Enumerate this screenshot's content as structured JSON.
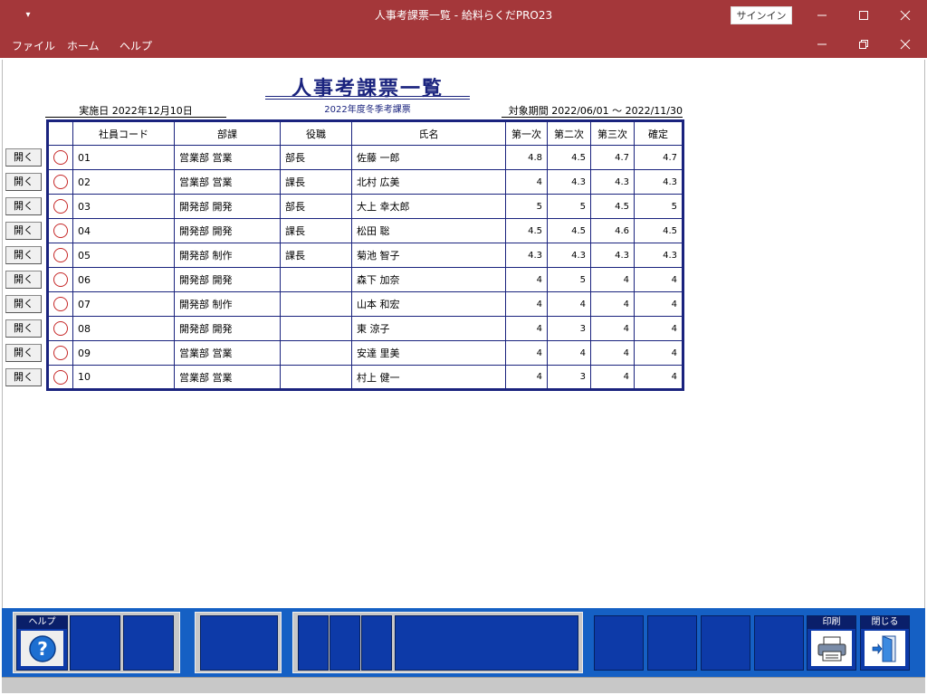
{
  "window": {
    "qat_glyph": "▾",
    "title": "人事考課票一覧 - 給料らくだPRO23",
    "signin_label": "サインイン"
  },
  "menu": {
    "items": [
      "ファイル",
      "ホーム",
      "ヘルプ"
    ]
  },
  "report": {
    "title": "人事考課票一覧",
    "subtitle": "2022年度冬季考課票",
    "implementation_date": "実施日 2022年12月10日",
    "period": "対象期間 2022/06/01 ～ 2022/11/30"
  },
  "table": {
    "headers": [
      "",
      "社員コード",
      "部課",
      "役職",
      "氏名",
      "第一次",
      "第二次",
      "第三次",
      "確定"
    ],
    "open_label": "開く",
    "rows": [
      {
        "code": "01",
        "dept": "営業部 営業",
        "position": "部長",
        "name": "佐藤 一郎",
        "r1": "4.8",
        "r2": "4.5",
        "r3": "4.7",
        "final": "4.7"
      },
      {
        "code": "02",
        "dept": "営業部 営業",
        "position": "課長",
        "name": "北村 広美",
        "r1": "4",
        "r2": "4.3",
        "r3": "4.3",
        "final": "4.3"
      },
      {
        "code": "03",
        "dept": "開発部 開発",
        "position": "部長",
        "name": "大上 幸太郎",
        "r1": "5",
        "r2": "5",
        "r3": "4.5",
        "final": "5"
      },
      {
        "code": "04",
        "dept": "開発部 開発",
        "position": "課長",
        "name": "松田 聡",
        "r1": "4.5",
        "r2": "4.5",
        "r3": "4.6",
        "final": "4.5"
      },
      {
        "code": "05",
        "dept": "開発部 制作",
        "position": "課長",
        "name": "菊池 智子",
        "r1": "4.3",
        "r2": "4.3",
        "r3": "4.3",
        "final": "4.3"
      },
      {
        "code": "06",
        "dept": "開発部 開発",
        "position": "",
        "name": "森下 加奈",
        "r1": "4",
        "r2": "5",
        "r3": "4",
        "final": "4"
      },
      {
        "code": "07",
        "dept": "開発部 制作",
        "position": "",
        "name": "山本 和宏",
        "r1": "4",
        "r2": "4",
        "r3": "4",
        "final": "4"
      },
      {
        "code": "08",
        "dept": "開発部 開発",
        "position": "",
        "name": "東 涼子",
        "r1": "4",
        "r2": "3",
        "r3": "4",
        "final": "4"
      },
      {
        "code": "09",
        "dept": "営業部 営業",
        "position": "",
        "name": "安達 里美",
        "r1": "4",
        "r2": "4",
        "r3": "4",
        "final": "4"
      },
      {
        "code": "10",
        "dept": "営業部 営業",
        "position": "",
        "name": "村上 健一",
        "r1": "4",
        "r2": "3",
        "r3": "4",
        "final": "4"
      }
    ]
  },
  "function_keys": {
    "help_label": "ヘルプ",
    "print_label": "印刷",
    "close_label": "閉じる"
  },
  "colors": {
    "titlebar": "#a4373a",
    "accent_navy": "#1a237e",
    "panel_blue": "#1560c4"
  }
}
